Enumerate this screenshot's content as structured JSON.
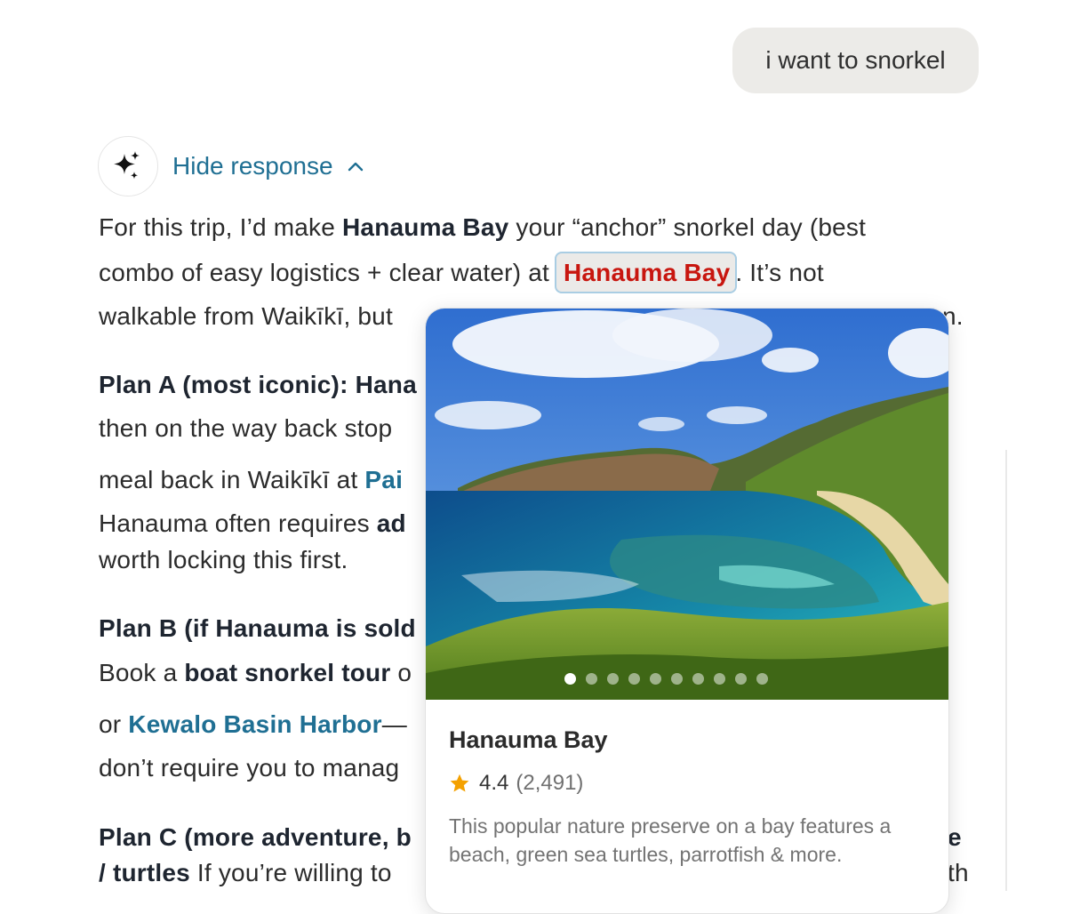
{
  "user_message": "i want to snorkel",
  "assistant": {
    "hide_response_label": "Hide response",
    "icon": "sparkle-icon",
    "chevron": "chevron-up-icon"
  },
  "paragraphs": {
    "p1": {
      "l1a": "For this trip, I’d make ",
      "l1b": "Hanauma Bay",
      "l1c": " your “anchor” snorkel day (best",
      "l2a": "combo of easy logistics + clear water) at ",
      "l2_link": "Hanauma Bay",
      "l2b": ". It’s not",
      "l3a": "walkable from Waikīkī, but ",
      "l3_end": "n."
    },
    "plan_a": {
      "title": "Plan A (most iconic): Hana",
      "l2": "then on the way back stop ",
      "l3a": "meal back in Waikīkī at ",
      "l3_link": "Pai",
      "l4a": "Hanauma often requires ",
      "l4b": "ad",
      "l5": "worth locking this first."
    },
    "plan_b": {
      "title": "Plan B (if Hanauma is sold",
      "l2a": "Book a ",
      "l2b": "boat snorkel tour",
      "l2c": " o",
      "l3a": "or ",
      "l3_link": "Kewalo Basin Harbor",
      "l3b": "—",
      "l4": "don’t require you to manag"
    },
    "plan_c": {
      "title": "Plan C (more adventure, b",
      "title_end": "e",
      "l2a": "/ turtles",
      "l2b": " If you’re willing to",
      "l2_end": "th"
    }
  },
  "place_card": {
    "name": "Hanauma Bay",
    "rating": "4.4",
    "review_count": "(2,491)",
    "description": "This popular nature preserve on a bay features a beach, green sea turtles, parrotfish & more.",
    "photo_count": 10,
    "active_photo": 1,
    "star_color": "#f4a100"
  },
  "colors": {
    "link": "#1f6f93",
    "highlight_text": "#c8160f",
    "highlight_bg": "#ebeae8",
    "highlight_border": "#a9cde3"
  }
}
